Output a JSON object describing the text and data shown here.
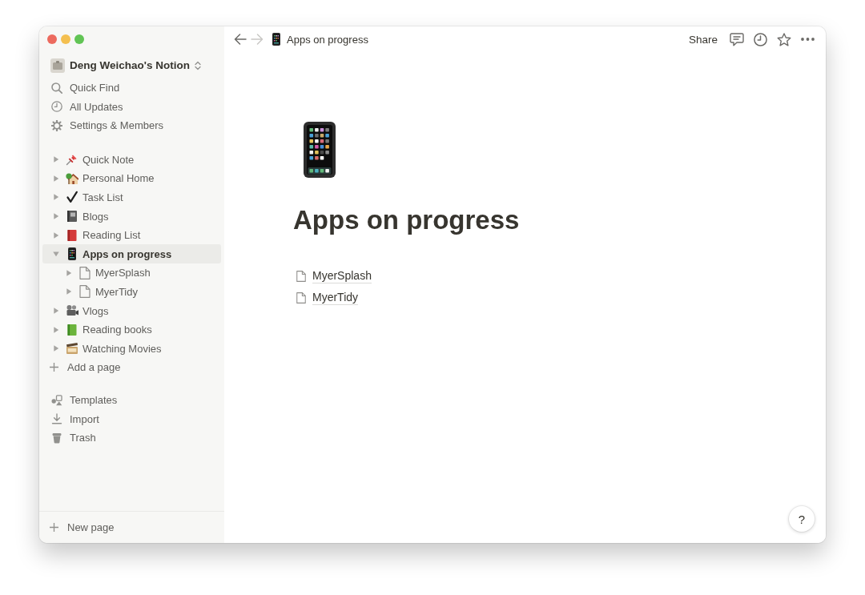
{
  "window": {
    "controls": [
      {
        "color": "#ec6a5e"
      },
      {
        "color": "#f4bf4f"
      },
      {
        "color": "#61c454"
      }
    ]
  },
  "sidebar": {
    "workspace": {
      "name": "Deng Weichao's Notion"
    },
    "top_items": [
      {
        "kind": "search",
        "label": "Quick Find"
      },
      {
        "kind": "updates",
        "label": "All Updates"
      },
      {
        "kind": "settings",
        "label": "Settings & Members"
      }
    ],
    "pages": [
      {
        "kind": "pushpin",
        "label": "Quick Note",
        "expanded": false,
        "selected": false
      },
      {
        "kind": "house",
        "label": "Personal Home",
        "expanded": false,
        "selected": false
      },
      {
        "kind": "checkmark",
        "label": "Task List",
        "expanded": false,
        "selected": false
      },
      {
        "kind": "notebook",
        "label": "Blogs",
        "expanded": false,
        "selected": false
      },
      {
        "kind": "redbook",
        "label": "Reading List",
        "expanded": false,
        "selected": false
      },
      {
        "kind": "phone",
        "label": "Apps on progress",
        "expanded": true,
        "selected": true,
        "children": [
          {
            "kind": "page",
            "label": "MyerSplash",
            "expanded": false,
            "selected": false
          },
          {
            "kind": "page",
            "label": "MyerTidy",
            "expanded": false,
            "selected": false
          }
        ]
      },
      {
        "kind": "projector",
        "label": "Vlogs",
        "expanded": false,
        "selected": false
      },
      {
        "kind": "greenbook",
        "label": "Reading books",
        "expanded": false,
        "selected": false
      },
      {
        "kind": "movies",
        "label": "Watching Movies",
        "expanded": false,
        "selected": false
      }
    ],
    "add_page": {
      "label": "Add a page"
    },
    "bottom_items": [
      {
        "kind": "templates",
        "label": "Templates"
      },
      {
        "kind": "import",
        "label": "Import"
      },
      {
        "kind": "trash",
        "label": "Trash"
      }
    ],
    "new_page": {
      "label": "New page"
    }
  },
  "topbar": {
    "nav": [
      {
        "kind": "back",
        "disabled": false
      },
      {
        "kind": "forward",
        "disabled": true
      }
    ],
    "breadcrumb": {
      "label": "Apps on progress"
    },
    "share": {
      "label": "Share"
    },
    "actions": [
      {
        "kind": "comments"
      },
      {
        "kind": "updates"
      },
      {
        "kind": "favorite"
      },
      {
        "kind": "more"
      }
    ]
  },
  "page": {
    "title": "Apps on progress",
    "subpages": [
      {
        "label": "MyerSplash"
      },
      {
        "label": "MyerTidy"
      }
    ]
  },
  "help_button": {
    "label": "?"
  }
}
